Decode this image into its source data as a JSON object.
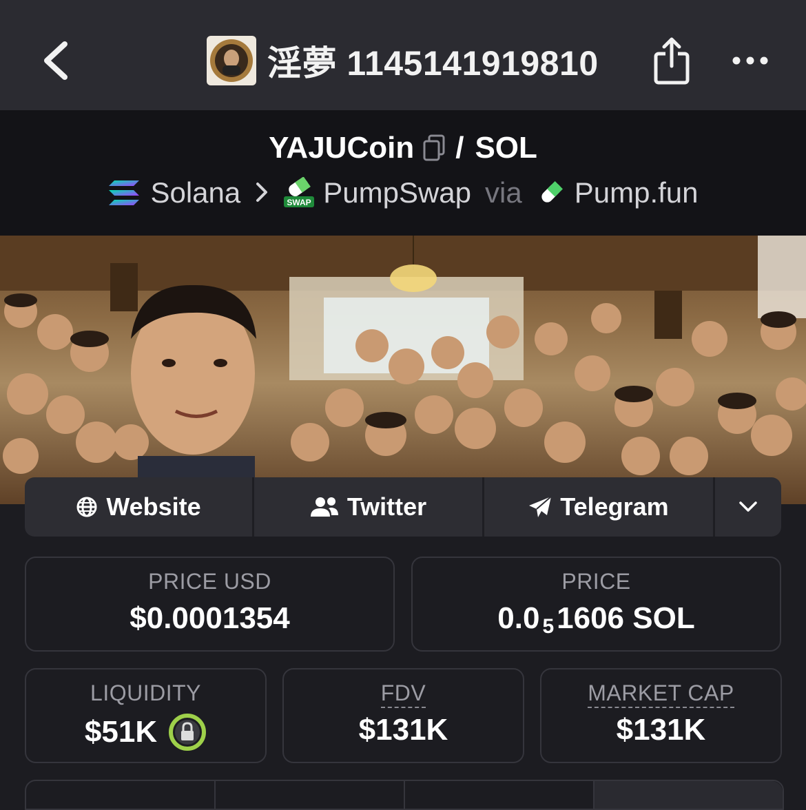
{
  "header": {
    "title": "淫夢 1145141919810"
  },
  "pair": {
    "base": "YAJUCoin",
    "separator": "/",
    "quote": "SOL"
  },
  "route": {
    "chain": "Solana",
    "dex": "PumpSwap",
    "via": "via",
    "launchpad": "Pump.fun",
    "swap_badge": "SWAP"
  },
  "links": {
    "website": "Website",
    "twitter": "Twitter",
    "telegram": "Telegram"
  },
  "stats": {
    "price_usd_label": "PRICE USD",
    "price_usd_value": "$0.0001354",
    "price_label": "PRICE",
    "price_prefix": "0.0",
    "price_subscript": "5",
    "price_suffix": "1606 SOL",
    "liquidity_label": "LIQUIDITY",
    "liquidity_value": "$51K",
    "fdv_label": "FDV",
    "fdv_value": "$131K",
    "mcap_label": "MARKET CAP",
    "mcap_value": "$131K"
  },
  "colors": {
    "background": "#1c1c21",
    "topbar": "#2b2b31",
    "pairbar": "#131317",
    "lock_ring": "#9ed04a"
  }
}
